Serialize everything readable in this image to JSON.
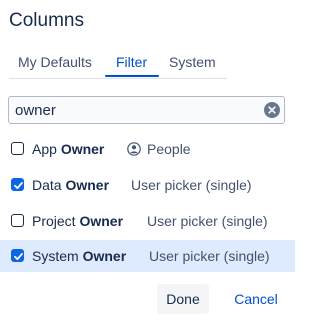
{
  "title": "Columns",
  "tabs": [
    {
      "label": "My Defaults"
    },
    {
      "label": "Filter"
    },
    {
      "label": "System"
    }
  ],
  "selected_tab": "Filter",
  "search": {
    "value": "owner"
  },
  "rows": [
    {
      "prefix": "App ",
      "match": "Owner",
      "type": "People",
      "checked": false,
      "type_icon": "person-circle-icon"
    },
    {
      "prefix": "Data ",
      "match": "Owner",
      "type": "User picker (single)",
      "checked": true
    },
    {
      "prefix": "Project ",
      "match": "Owner",
      "type": "User picker (single)",
      "checked": false
    },
    {
      "prefix": "System ",
      "match": "Owner",
      "type": "User picker (single)",
      "checked": true,
      "highlighted": true
    }
  ],
  "buttons": {
    "done": "Done",
    "cancel": "Cancel"
  },
  "colors": {
    "accent": "#0052cc",
    "checkbox": "#0c66e4",
    "highlight": "#deebff"
  }
}
